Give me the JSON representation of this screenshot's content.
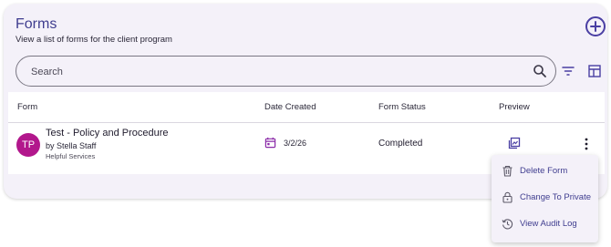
{
  "header": {
    "title": "Forms",
    "subtitle": "View a list of forms for the client program"
  },
  "toolbar": {
    "add_icon": "plus-circle-icon",
    "search_placeholder": "Search",
    "filter_icon": "filter-icon",
    "columns_icon": "table-layout-icon"
  },
  "table": {
    "columns": [
      "Form",
      "Date Created",
      "Form Status",
      "Preview"
    ],
    "rows": [
      {
        "avatar_initials": "TP",
        "avatar_color": "#b2178c",
        "title": "Test - Policy and Procedure",
        "author": "by Stella Staff",
        "organization": "Helpful Services",
        "date_created": "3/2/26",
        "status": "Completed"
      }
    ]
  },
  "context_menu": {
    "items": [
      {
        "label": "Delete Form",
        "icon": "trash-icon"
      },
      {
        "label": "Change To Private",
        "icon": "lock-icon"
      },
      {
        "label": "View Audit Log",
        "icon": "history-icon"
      }
    ]
  },
  "colors": {
    "accent": "#3f3d8f",
    "card_background": "#f4f1f9"
  }
}
